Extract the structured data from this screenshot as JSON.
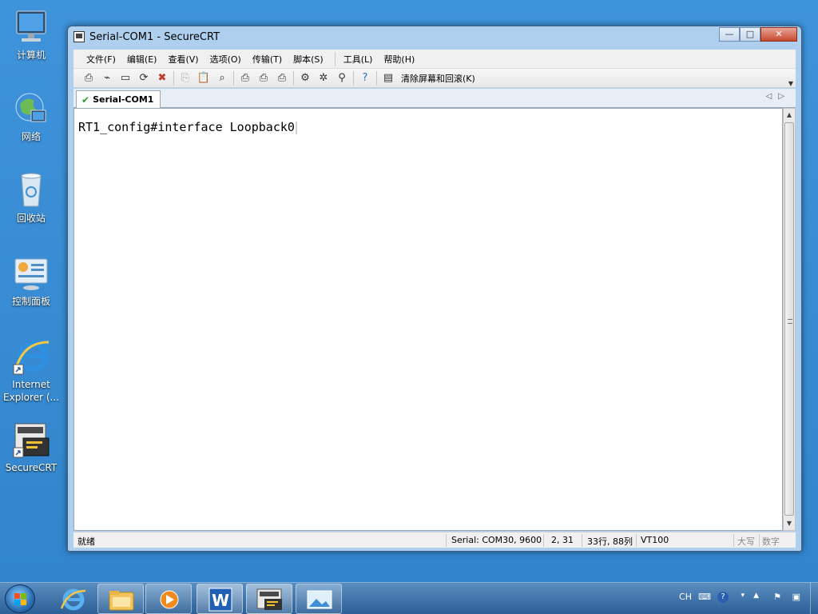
{
  "desktop": {
    "icons": [
      {
        "label": "计算机",
        "icon": "computer-icon"
      },
      {
        "label": "网络",
        "icon": "network-globe-icon"
      },
      {
        "label": "回收站",
        "icon": "recycle-bin-icon"
      },
      {
        "label": "控制面板",
        "icon": "control-panel-icon"
      },
      {
        "label": "Internet Explorer (...",
        "icon": "internet-explorer-icon"
      },
      {
        "label": "SecureCRT",
        "icon": "securecrt-icon"
      }
    ]
  },
  "window": {
    "title": "Serial-COM1 - SecureCRT",
    "buttons": {
      "minimize": "—",
      "maximize": "□",
      "close": "✕"
    }
  },
  "menu": {
    "items": [
      "文件(F)",
      "编辑(E)",
      "查看(V)",
      "选项(O)",
      "传输(T)",
      "脚本(S)",
      "工具(L)",
      "帮助(H)"
    ]
  },
  "toolbar": {
    "clear_label": "清除屏幕和回滚(K)",
    "icons": [
      "connect-icon",
      "quick-connect-icon",
      "connect-in-tab-icon",
      "reconnect-icon",
      "disconnect-icon",
      "copy-icon",
      "paste-icon",
      "find-icon",
      "print-screen-icon",
      "print-selection-icon",
      "print-icon",
      "session-options-icon",
      "global-options-icon",
      "keymap-icon",
      "help-icon",
      "clear-screen-icon"
    ]
  },
  "tabs": [
    {
      "label": "Serial-COM1",
      "status": "connected-check-icon"
    }
  ],
  "terminal": {
    "line": "RT1_config#interface Loopback0"
  },
  "status": {
    "ready": "就绪",
    "connection": "Serial: COM30, 9600",
    "cursor_pos": "2,  31",
    "dimensions": "33行, 88列",
    "emulation": "VT100",
    "caps": "大写",
    "num": "数字"
  },
  "taskbar": {
    "apps": [
      "start-button",
      "internet-explorer-icon",
      "file-explorer-icon",
      "media-player-icon",
      "word-icon",
      "securecrt-icon",
      "picture-viewer-icon"
    ],
    "tray": {
      "lang": "CH"
    }
  }
}
